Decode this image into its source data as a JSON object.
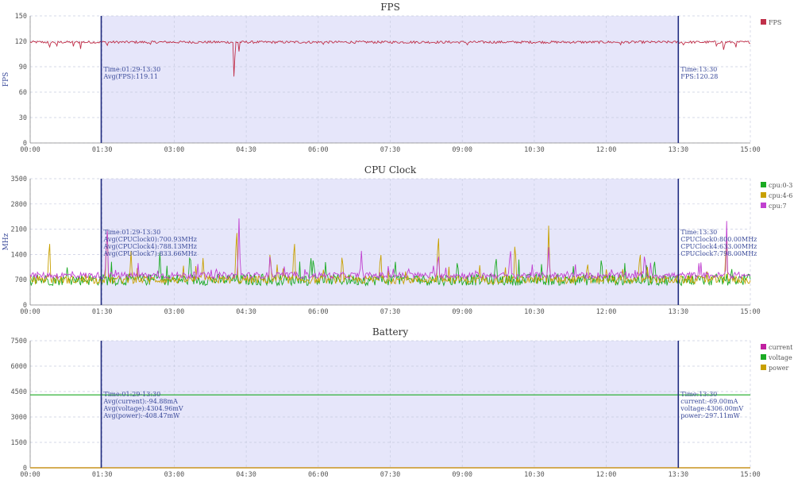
{
  "x_ticks": [
    "00:00",
    "01:30",
    "03:00",
    "04:30",
    "06:00",
    "07:30",
    "09:00",
    "10:30",
    "12:00",
    "13:30",
    "15:00"
  ],
  "chart_data": [
    {
      "type": "line",
      "title": "FPS",
      "xlabel": "",
      "ylabel": "FPS",
      "ylim": [
        0,
        150
      ],
      "yticks": [
        0,
        30,
        60,
        90,
        120,
        150
      ],
      "xlim": [
        0,
        15
      ],
      "grid": true,
      "legend_position": "top-right",
      "selection": {
        "start": 1.48,
        "end": 13.5
      },
      "series": [
        {
          "name": "FPS",
          "color": "#c0304a",
          "baseline": 119,
          "noise": 1.5,
          "dips": [
            [
              0.4,
              110
            ],
            [
              0.55,
              112
            ],
            [
              0.9,
              114
            ],
            [
              1.05,
              111
            ],
            [
              1.6,
              113
            ],
            [
              2.5,
              115
            ],
            [
              4.25,
              56
            ],
            [
              4.35,
              108
            ],
            [
              6.1,
              115
            ],
            [
              9.1,
              114
            ],
            [
              12.3,
              116
            ],
            [
              13.6,
              114
            ],
            [
              14.3,
              112
            ],
            [
              14.45,
              105
            ],
            [
              14.7,
              113
            ]
          ]
        }
      ],
      "annotations": {
        "left": [
          "Time:01:29-13:30",
          "Avg(FPS):119.11"
        ],
        "right": [
          "Time:13:30",
          "FPS:120.28"
        ]
      }
    },
    {
      "type": "line",
      "title": "CPU Clock",
      "xlabel": "",
      "ylabel": "MHz",
      "ylim": [
        0,
        3500
      ],
      "yticks": [
        0,
        700,
        1400,
        2100,
        2800,
        3500
      ],
      "xlim": [
        0,
        15
      ],
      "grid": true,
      "legend_position": "top-right",
      "selection": {
        "start": 1.48,
        "end": 13.5
      },
      "series": [
        {
          "name": "cpu:0-3",
          "color": "#1aaa22",
          "baseline": 700,
          "noise": 160,
          "spikes": [
            [
              2.7,
              1450
            ],
            [
              5.9,
              1400
            ],
            [
              7.6,
              1350
            ],
            [
              8.9,
              1300
            ],
            [
              9.7,
              1450
            ],
            [
              11.9,
              1400
            ],
            [
              13.0,
              1350
            ]
          ]
        },
        {
          "name": "cpu:4-6",
          "color": "#c8a000",
          "baseline": 700,
          "noise": 110,
          "spikes": [
            [
              0.4,
              2000
            ],
            [
              1.6,
              2450
            ],
            [
              2.1,
              1500
            ],
            [
              3.6,
              1300
            ],
            [
              4.3,
              2400
            ],
            [
              5.0,
              1600
            ],
            [
              5.5,
              2000
            ],
            [
              6.5,
              1500
            ],
            [
              7.3,
              1600
            ],
            [
              8.5,
              2200
            ],
            [
              10.1,
              1900
            ],
            [
              10.8,
              2200
            ],
            [
              11.6,
              1500
            ],
            [
              12.7,
              1600
            ],
            [
              14.5,
              2100
            ]
          ]
        },
        {
          "name": "cpu:7",
          "color": "#c040d0",
          "baseline": 820,
          "noise": 90,
          "spikes": [
            [
              1.6,
              2450
            ],
            [
              4.35,
              2400
            ],
            [
              5.0,
              1500
            ],
            [
              6.9,
              1500
            ],
            [
              8.5,
              1500
            ],
            [
              10.0,
              1700
            ],
            [
              10.8,
              1600
            ],
            [
              12.8,
              1500
            ],
            [
              14.5,
              2800
            ]
          ]
        }
      ],
      "annotations": {
        "left": [
          "Time:01:29-13:30",
          "Avg(CPUClock0):700.93MHz",
          "Avg(CPUClock4):788.13MHz",
          "Avg(CPUClock7):833.66MHz"
        ],
        "right": [
          "Time:13:30",
          "CPUClock0:800.00MHz",
          "CPUClock4:633.00MHz",
          "CPUClock7:798.00MHz"
        ]
      }
    },
    {
      "type": "line",
      "title": "Battery",
      "xlabel": "",
      "ylabel": "",
      "ylim": [
        0,
        7500
      ],
      "yticks": [
        0,
        1500,
        3000,
        4500,
        6000,
        7500
      ],
      "xlim": [
        0,
        15
      ],
      "grid": true,
      "legend_position": "top-right",
      "selection": {
        "start": 1.48,
        "end": 13.5
      },
      "series": [
        {
          "name": "current",
          "color": "#c020a0",
          "constant": -94.88
        },
        {
          "name": "voltage",
          "color": "#1aaa22",
          "constant": 4304.96
        },
        {
          "name": "power",
          "color": "#c8a000",
          "constant": -408.47
        }
      ],
      "annotations": {
        "left": [
          "Time:01:29-13:30",
          "Avg(current):-94.88mA",
          "Avg(voltage):4304.96mV",
          "Avg(power):-408.47mW"
        ],
        "right": [
          "Time:13:30",
          "current:-69.00mA",
          "voltage:4306.00mV",
          "power:-297.11mW"
        ]
      }
    }
  ]
}
